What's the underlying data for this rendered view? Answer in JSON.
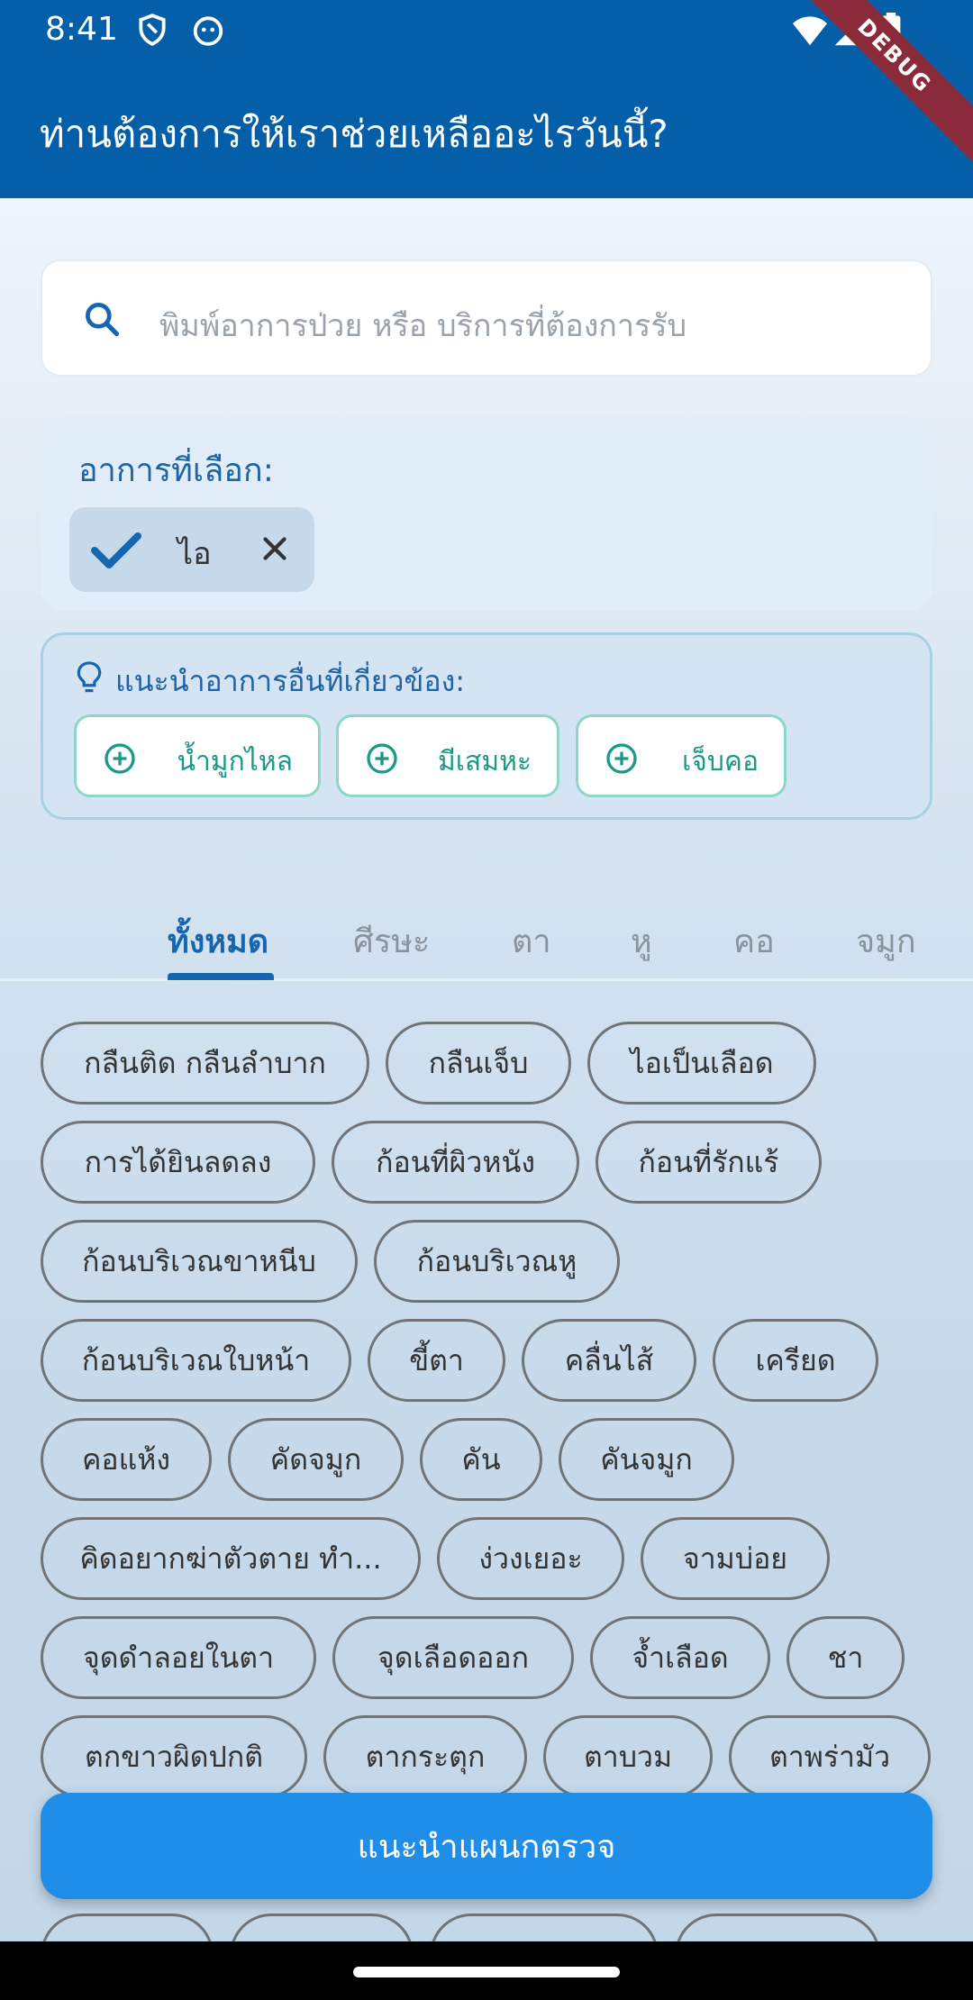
{
  "status_bar": {
    "time": "8:41",
    "icons": [
      "shield-icon",
      "cat-face-icon",
      "wifi-icon",
      "signal-icon",
      "battery-icon"
    ]
  },
  "debug_banner": "DEBUG",
  "appbar": {
    "title": "ท่านต้องการให้เราช่วยเหลืออะไรวันนี้?"
  },
  "search": {
    "placeholder": "พิมพ์อาการป่วย หรือ บริการที่ต้องการรับ"
  },
  "selected": {
    "title": "อาการที่เลือก:",
    "chips": [
      {
        "label": "ไอ"
      }
    ]
  },
  "suggestions": {
    "title": "แนะนำอาการอื่นที่เกี่ยวข้อง:",
    "chips": [
      {
        "label": "น้ำมูกไหล"
      },
      {
        "label": "มีเสมหะ"
      },
      {
        "label": "เจ็บคอ"
      }
    ]
  },
  "tabs": [
    {
      "label": "ทั้งหมด",
      "active": true
    },
    {
      "label": "ศีรษะ",
      "active": false
    },
    {
      "label": "ตา",
      "active": false
    },
    {
      "label": "หู",
      "active": false
    },
    {
      "label": "คอ",
      "active": false
    },
    {
      "label": "จมูก",
      "active": false
    }
  ],
  "symptoms": [
    "กลืนติด กลืนลำบาก",
    "กลืนเจ็บ",
    "ไอเป็นเลือด",
    "การได้ยินลดลง",
    "ก้อนที่ผิวหนัง",
    "ก้อนที่รักแร้",
    "ก้อนบริเวณขาหนีบ",
    "ก้อนบริเวณหู",
    "ก้อนบริเวณใบหน้า",
    "ขี้ตา",
    "คลื่นไส้",
    "เครียด",
    "คอแห้ง",
    "คัดจมูก",
    "คัน",
    "คันจมูก",
    "คิดอยากฆ่าตัวตาย ทำ...",
    "ง่วงเยอะ",
    "จามบ่อย",
    "จุดดำลอยในตา",
    "จุดเลือดออก",
    "จ้ำเลือด",
    "ชา",
    "ตกขาวผิดปกติ",
    "ตากระตุก",
    "ตาบวม",
    "ตาพร่ามัว"
  ],
  "cta": {
    "label": "แนะนำแผนกตรวจ"
  },
  "colors": {
    "primary": "#045fa8",
    "accent": "#1f8ee8",
    "teal": "#1a9a85",
    "tab_active": "#1565b0"
  }
}
